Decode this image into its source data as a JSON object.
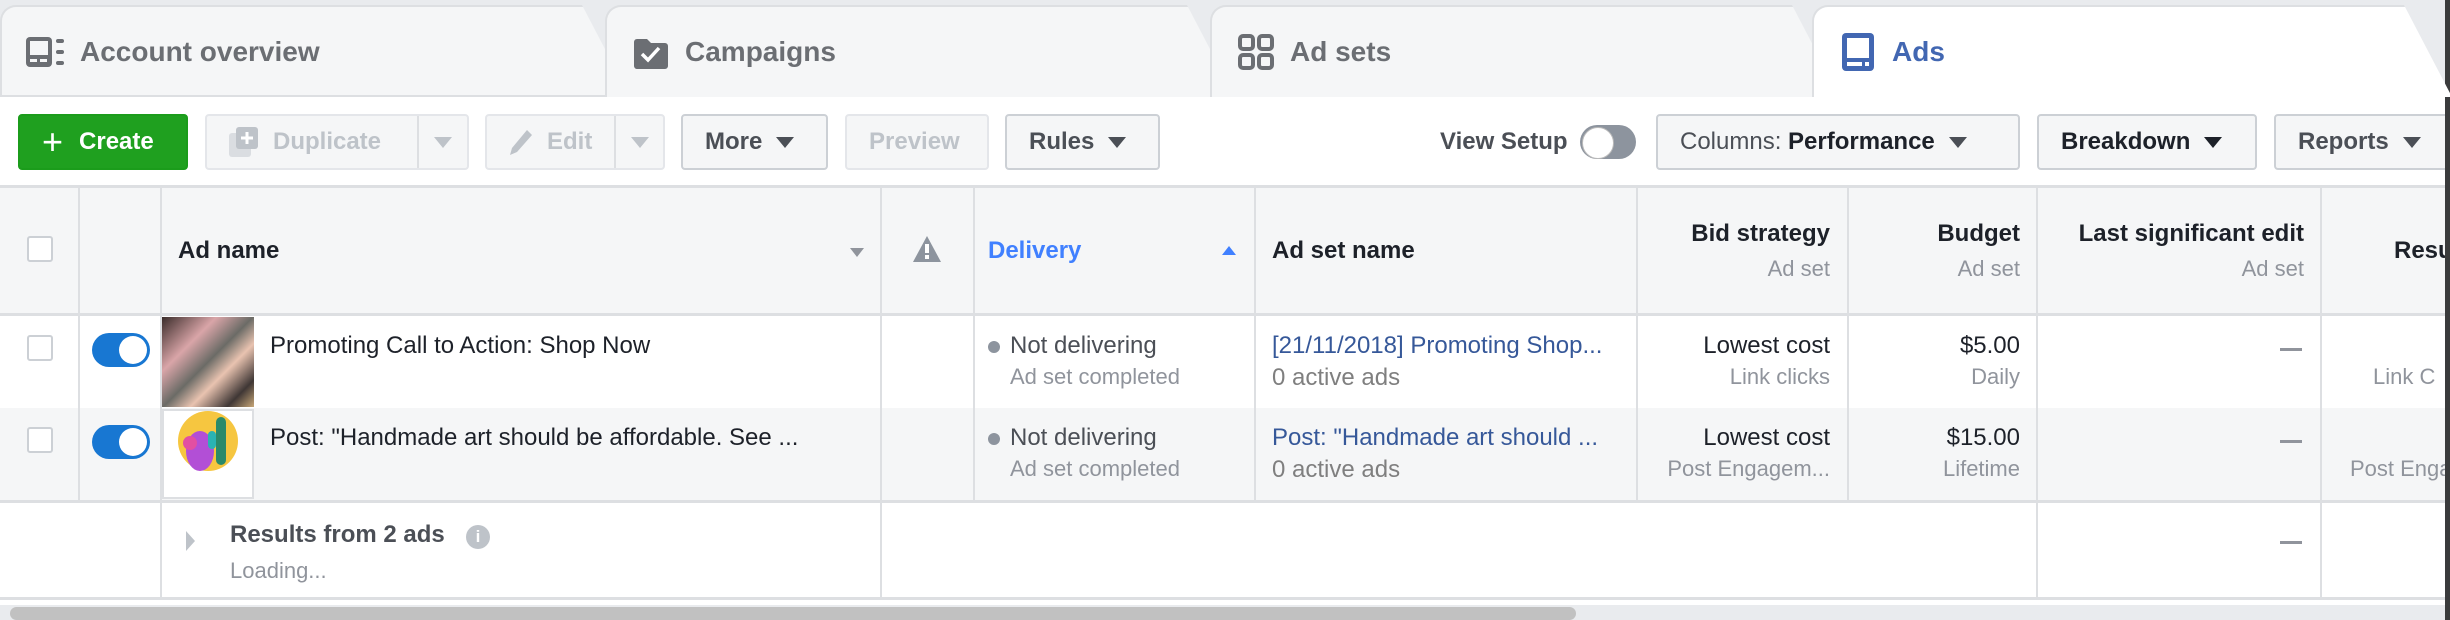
{
  "tabs": [
    {
      "label": "Account overview",
      "icon": "account-overview-icon",
      "active": false
    },
    {
      "label": "Campaigns",
      "icon": "campaigns-folder-check-icon",
      "active": false
    },
    {
      "label": "Ad sets",
      "icon": "ad-sets-grid-icon",
      "active": false
    },
    {
      "label": "Ads",
      "icon": "ads-icon",
      "active": true
    }
  ],
  "toolbar": {
    "create_label": "Create",
    "duplicate_label": "Duplicate",
    "edit_label": "Edit",
    "more_label": "More",
    "preview_label": "Preview",
    "rules_label": "Rules",
    "view_setup_label": "View Setup",
    "view_setup_on": false,
    "columns_prefix": "Columns:",
    "columns_value": "Performance",
    "breakdown_label": "Breakdown",
    "reports_label": "Reports"
  },
  "colors": {
    "create_green": "#1fa01f",
    "active_tab_blue": "#4267b2",
    "toggle_blue": "#1877d2",
    "sort_blue": "#4080ff",
    "link_blue": "#365899"
  },
  "table": {
    "columns": [
      {
        "key": "select",
        "label": ""
      },
      {
        "key": "on_off",
        "label": ""
      },
      {
        "key": "ad_name",
        "label": "Ad name",
        "sort": "down"
      },
      {
        "key": "warnings",
        "label": "",
        "icon": "warning-icon"
      },
      {
        "key": "delivery",
        "label": "Delivery",
        "sort": "up",
        "active_sort": true
      },
      {
        "key": "ad_set_name",
        "label": "Ad set name"
      },
      {
        "key": "bid_strategy",
        "label": "Bid strategy",
        "sub": "Ad set"
      },
      {
        "key": "budget",
        "label": "Budget",
        "sub": "Ad set"
      },
      {
        "key": "last_edit",
        "label": "Last significant edit",
        "sub": "Ad set"
      },
      {
        "key": "results",
        "label": "Resu"
      }
    ],
    "rows": [
      {
        "ad_name": "Promoting Call to Action: Shop Now",
        "on": true,
        "delivery": "Not delivering",
        "delivery_sub": "Ad set completed",
        "ad_set_name": "[21/11/2018] Promoting Shop...",
        "ad_set_sub": "0 active ads",
        "bid_strategy": "Lowest cost",
        "bid_sub": "Link clicks",
        "budget": "$5.00",
        "budget_sub": "Daily",
        "last_edit": "—",
        "results_sub": "Link C"
      },
      {
        "ad_name": "Post: \"Handmade art should be affordable. See ...",
        "on": true,
        "delivery": "Not delivering",
        "delivery_sub": "Ad set completed",
        "ad_set_name": "Post: \"Handmade art should ...",
        "ad_set_sub": "0 active ads",
        "bid_strategy": "Lowest cost",
        "bid_sub": "Post Engagem...",
        "budget": "$15.00",
        "budget_sub": "Lifetime",
        "last_edit": "—",
        "results_sub": "Post Enga"
      }
    ],
    "summary": {
      "label": "Results from 2 ads",
      "status": "Loading...",
      "last_edit": "—"
    }
  }
}
